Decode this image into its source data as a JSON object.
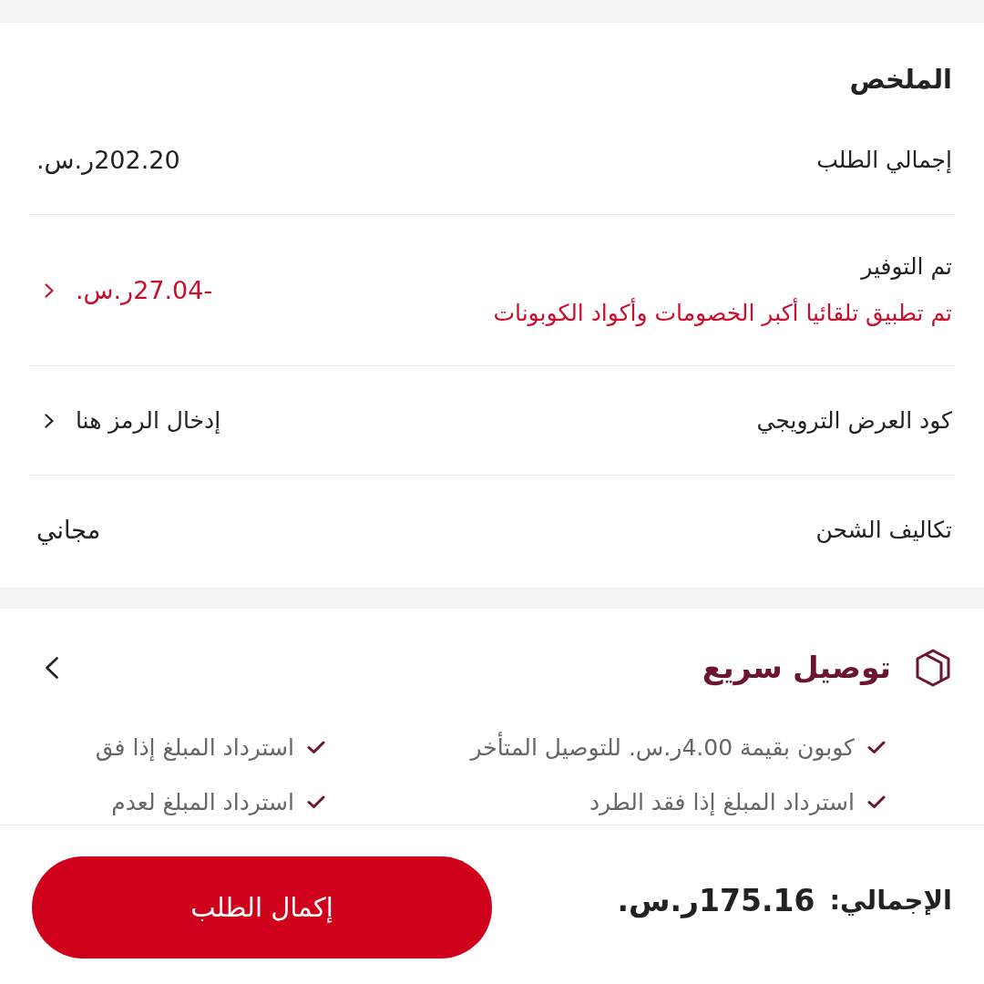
{
  "summary": {
    "title": "الملخص",
    "rows": [
      {
        "kind": "plain",
        "label": "إجمالي الطلب",
        "value": "202.20ر.س."
      },
      {
        "kind": "savings",
        "label": "تم التوفير",
        "note": "تم تطبيق تلقائيا أكبر الخصومات وأكواد الكوبونات",
        "value": "-27.04ر.س."
      },
      {
        "kind": "link",
        "label": "كود العرض الترويجي",
        "value": "إدخال الرمز هنا"
      },
      {
        "kind": "plain",
        "label": "تكاليف الشحن",
        "value": "مجاني"
      }
    ]
  },
  "delivery": {
    "title": "توصيل سريع",
    "features": [
      "كوبون بقيمة 4.00ر.س. للتوصيل المتأخر",
      "استرداد المبلغ إذا فق",
      "استرداد المبلغ إذا فقد الطرد",
      "استرداد المبلغ لعدم"
    ]
  },
  "footer": {
    "total_label": "الإجمالي:",
    "total": "175.16ر.س.",
    "button": "إكمال الطلب"
  }
}
